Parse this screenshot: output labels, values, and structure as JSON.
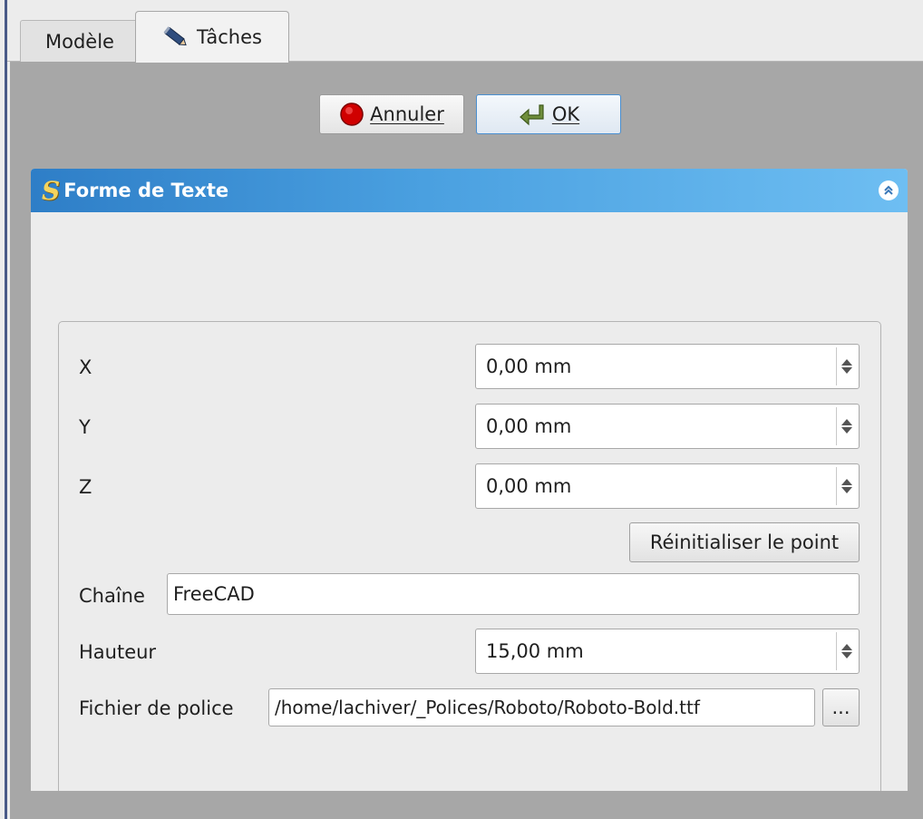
{
  "tabs": {
    "model_label": "Modèle",
    "tasks_label": "Tâches"
  },
  "actions": {
    "cancel_label": "Annuler",
    "ok_label": "OK"
  },
  "panel": {
    "title": "Forme de Texte",
    "x_label": "X",
    "x_value": "0,00 mm",
    "y_label": "Y",
    "y_value": "0,00 mm",
    "z_label": "Z",
    "z_value": "0,00 mm",
    "reset_point_label": "Réinitialiser le point",
    "string_label": "Chaîne",
    "string_value": "FreeCAD",
    "height_label": "Hauteur",
    "height_value": "15,00 mm",
    "font_file_label": "Fichier de police",
    "font_file_value": "/home/lachiver/_Polices/Roboto/Roboto-Bold.ttf",
    "browse_label": "..."
  },
  "icons": {
    "tasks": "pencil-icon",
    "cancel": "stop-icon",
    "ok": "return-arrow-icon",
    "panel": "text-shape-icon",
    "collapse": "collapse-chevrons-icon"
  },
  "colors": {
    "header_start": "#2e7ec7",
    "header_end": "#6ebef2",
    "panel_background": "#a7a7a7",
    "ok_border": "#4a8fd0",
    "cancel_icon": "#d00000"
  }
}
